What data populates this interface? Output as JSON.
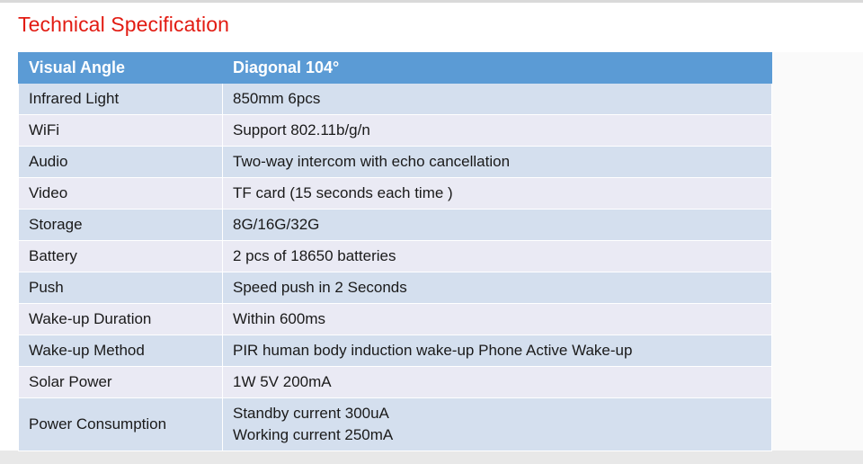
{
  "title": "Technical Specification",
  "colors": {
    "title_red": "#e21b12",
    "header_blue": "#5b9bd5",
    "row_odd": "#d4dfee",
    "row_even": "#eaeaf4",
    "page_background": "#ffffff",
    "bottom_band": "#e8e8e8",
    "top_rule": "#d9d9d9",
    "text": "#1a1a1a",
    "header_text": "#ffffff"
  },
  "table": {
    "header": {
      "label": "Visual Angle",
      "value": "Diagonal 104°"
    },
    "rows": [
      {
        "label": "Infrared Light",
        "value": "850mm 6pcs"
      },
      {
        "label": "WiFi",
        "value": "Support 802.11b/g/n"
      },
      {
        "label": "Audio",
        "value": "Two-way intercom with echo cancellation"
      },
      {
        "label": "Video",
        "value": "TF card (15 seconds each time )"
      },
      {
        "label": "Storage",
        "value": "8G/16G/32G"
      },
      {
        "label": "Battery",
        "value": "2 pcs of 18650 batteries"
      },
      {
        "label": "Push",
        "value": "Speed push in 2 Seconds"
      },
      {
        "label": "Wake-up Duration",
        "value": "Within 600ms"
      },
      {
        "label": "Wake-up Method",
        "value": "PIR human body induction wake-up Phone Active Wake-up"
      },
      {
        "label": "Solar Power",
        "value": "1W 5V 200mA"
      },
      {
        "label": "Power Consumption",
        "value_line1": "Standby current 300uA",
        "value_line2": "Working current 250mA"
      }
    ]
  }
}
